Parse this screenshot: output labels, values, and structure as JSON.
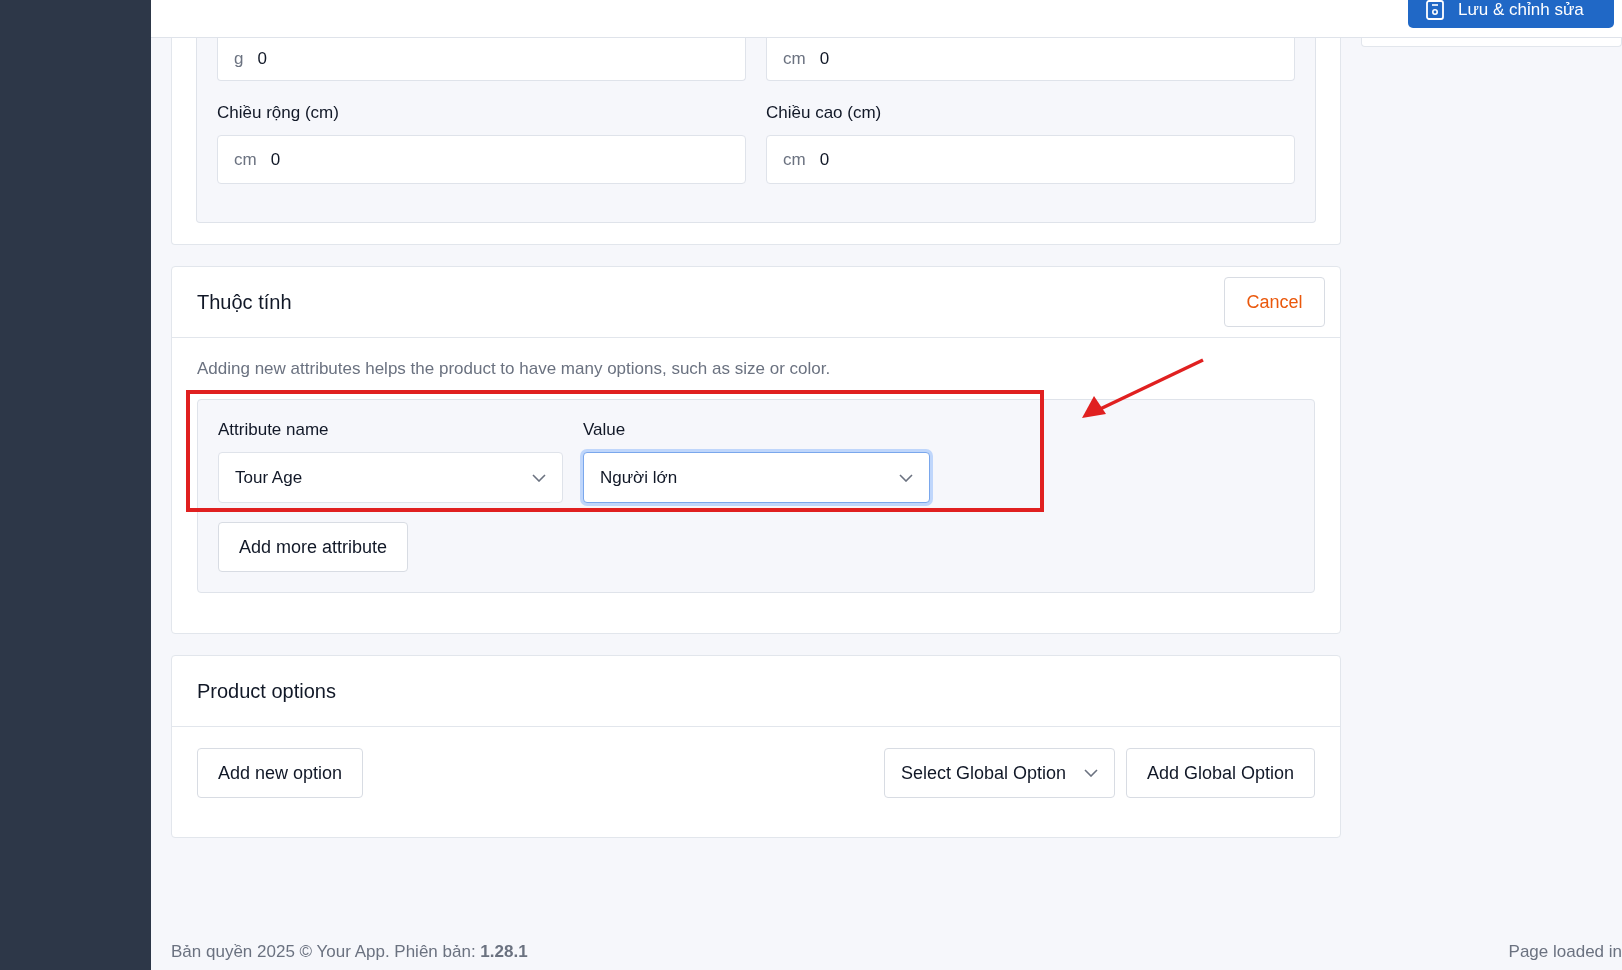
{
  "header": {
    "save_button": "Lưu & chỉnh sửa"
  },
  "dimensions": {
    "fields": [
      {
        "unit": "g",
        "value": "0"
      },
      {
        "unit": "cm",
        "value": "0"
      }
    ],
    "labeled_fields": [
      {
        "label": "Chiều rộng (cm)",
        "unit": "cm",
        "value": "0"
      },
      {
        "label": "Chiều cao (cm)",
        "unit": "cm",
        "value": "0"
      }
    ]
  },
  "attributes": {
    "title": "Thuộc tính",
    "cancel_button": "Cancel",
    "description": "Adding new attributes helps the product to have many options, such as size or color.",
    "selects": [
      {
        "label": "Attribute name",
        "value": "Tour Age",
        "focused": false
      },
      {
        "label": "Value",
        "value": "Người lớn",
        "focused": true
      }
    ],
    "add_button": "Add more attribute"
  },
  "product_options": {
    "title": "Product options",
    "add_button": "Add new option",
    "global_select": "Select Global Option",
    "add_global_button": "Add Global Option"
  },
  "footer": {
    "copyright": "Bản quyền 2025 © Your App. Phiên bản: **1.28.1**",
    "load_time": "Page loaded in"
  }
}
